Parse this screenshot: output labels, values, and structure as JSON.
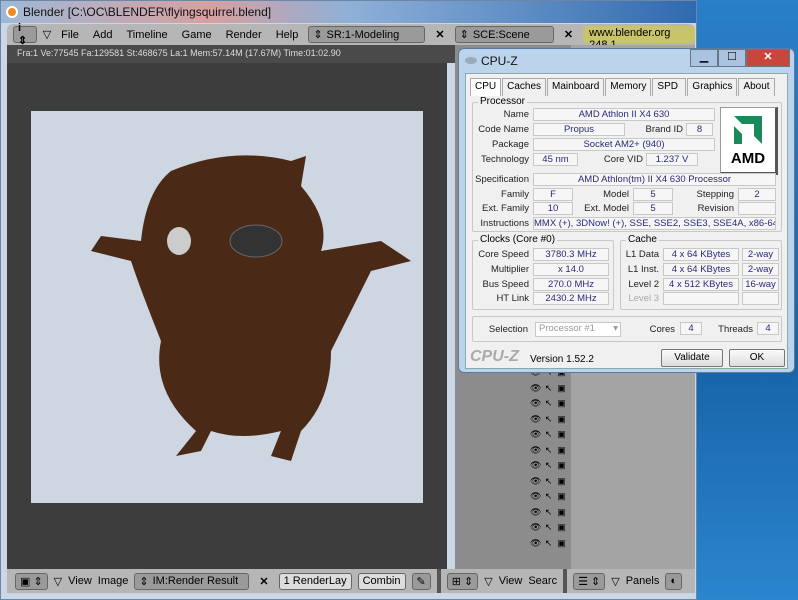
{
  "blender": {
    "title": "Blender [C:\\OC\\BLENDER\\flyingsquirrel.blend]",
    "menu": [
      "File",
      "Add",
      "Timeline",
      "Game",
      "Render",
      "Help"
    ],
    "screen": "SR:1-Modeling",
    "scene": "SCE:Scene",
    "url": "www.blender.org 248.1",
    "info": "Fra:1  Ve:77545 Fa:129581 St:468675 La:1 Mem:57.14M (17.67M) Time:01:02.90",
    "footer": {
      "view": "View",
      "image": "Image",
      "image_name": "IM:Render Result",
      "layer": "1 RenderLay",
      "pass": "Combin",
      "outliner_view": "View",
      "search": "Searc",
      "panels": "Panels"
    }
  },
  "cpuz": {
    "title": "CPU-Z",
    "tabs": [
      "CPU",
      "Caches",
      "Mainboard",
      "Memory",
      "SPD",
      "Graphics",
      "About"
    ],
    "processor_label": "Processor",
    "labels": {
      "name": "Name",
      "code_name": "Code Name",
      "brand_id": "Brand ID",
      "package": "Package",
      "technology": "Technology",
      "core_vid": "Core VID",
      "specification": "Specification",
      "family": "Family",
      "model": "Model",
      "stepping": "Stepping",
      "ext_family": "Ext. Family",
      "ext_model": "Ext. Model",
      "revision": "Revision",
      "instructions": "Instructions"
    },
    "values": {
      "name": "AMD Athlon II X4 630",
      "code_name": "Propus",
      "brand_id": "8",
      "package": "Socket AM2+ (940)",
      "technology": "45 nm",
      "core_vid": "1.237 V",
      "specification": "AMD Athlon(tm) II X4 630 Processor",
      "family": "F",
      "model": "5",
      "stepping": "2",
      "ext_family": "10",
      "ext_model": "5",
      "revision": "",
      "instructions": "MMX (+), 3DNow! (+), SSE, SSE2, SSE3, SSE4A, x86-64"
    },
    "logo": "AMD",
    "clocks": {
      "label": "Clocks (Core #0)",
      "core_speed_l": "Core Speed",
      "core_speed": "3780.3 MHz",
      "multiplier_l": "Multiplier",
      "multiplier": "x 14.0",
      "bus_speed_l": "Bus Speed",
      "bus_speed": "270.0 MHz",
      "ht_link_l": "HT Link",
      "ht_link": "2430.2 MHz"
    },
    "cache": {
      "label": "Cache",
      "l1d_l": "L1 Data",
      "l1d": "4 x 64 KBytes",
      "l1d_w": "2-way",
      "l1i_l": "L1 Inst.",
      "l1i": "4 x 64 KBytes",
      "l1i_w": "2-way",
      "l2_l": "Level 2",
      "l2": "4 x 512 KBytes",
      "l2_w": "16-way",
      "l3_l": "Level 3"
    },
    "selection_l": "Selection",
    "selection": "Processor #1",
    "cores_l": "Cores",
    "cores": "4",
    "threads_l": "Threads",
    "threads": "4",
    "brand": "CPU-Z",
    "version": "Version 1.52.2",
    "validate": "Validate",
    "ok": "OK"
  }
}
